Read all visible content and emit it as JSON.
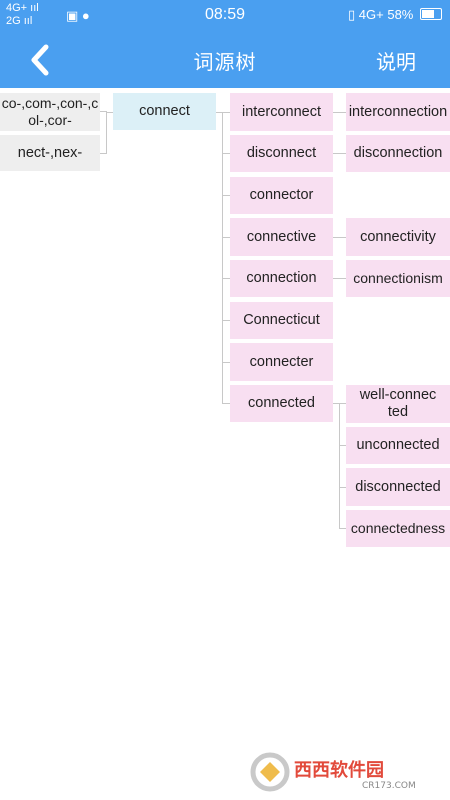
{
  "status": {
    "signal_top": "4G+ ııl",
    "signal_bottom": "2G ııl",
    "time": "08:59",
    "right_network": "4G+",
    "battery": "58%"
  },
  "header": {
    "title": "词源树",
    "help_label": "说明",
    "back_icon": "chevron-left-icon"
  },
  "tree": {
    "roots": [
      "co-,com-,con-,col-,cor-",
      "nect-,nex-"
    ],
    "center": "connect",
    "children": [
      "interconnect",
      "disconnect",
      "connector",
      "connective",
      "connection",
      "Connecticut",
      "connecter",
      "connected"
    ],
    "grandchildren": {
      "interconnect": [
        "interconnection"
      ],
      "disconnect": [
        "disconnection"
      ],
      "connective": [
        "connectivity"
      ],
      "connection": [
        "connectionism"
      ],
      "connected": [
        "well-connected",
        "unconnected",
        "disconnected",
        "connectedness"
      ]
    }
  },
  "watermark": {
    "text": "西西软件园",
    "sub": "CR173.COM"
  },
  "colors": {
    "accent": "#4a9ff0",
    "root": "#eeeeee",
    "center": "#dcf0f7",
    "derived": "#f8dff1"
  }
}
